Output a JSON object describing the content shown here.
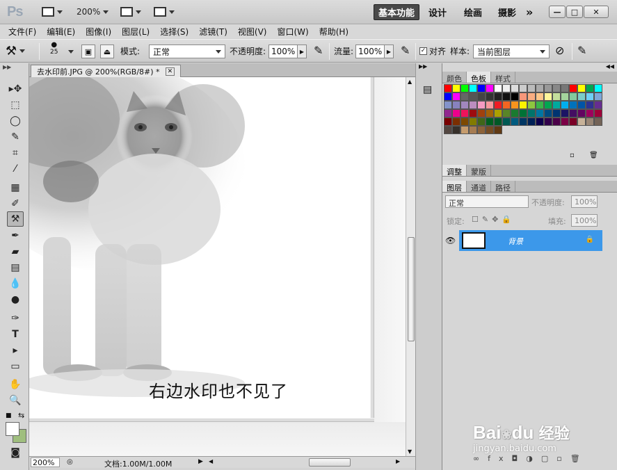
{
  "app": {
    "logo": "Ps",
    "zoom": "200%"
  },
  "workspaces": {
    "active": "基本功能",
    "design": "设计",
    "painting": "绘画",
    "photography": "摄影",
    "more": "»"
  },
  "window_controls": {
    "minimize": "—",
    "maximize": "□",
    "close": "✕"
  },
  "menu": [
    "文件(F)",
    "编辑(E)",
    "图像(I)",
    "图层(L)",
    "选择(S)",
    "滤镜(T)",
    "视图(V)",
    "窗口(W)",
    "帮助(H)"
  ],
  "options": {
    "brush_size": "25",
    "mode_label": "模式:",
    "mode_value": "正常",
    "opacity_label": "不透明度:",
    "opacity_value": "100%",
    "flow_label": "流量:",
    "flow_value": "100%",
    "align_label": "对齐",
    "sample_label": "样本:",
    "sample_value": "当前图层"
  },
  "document": {
    "tab_title": "去水印前.JPG @ 200%(RGB/8#) *",
    "caption": "右边水印也不见了"
  },
  "status": {
    "zoom": "200%",
    "doc_info": "文档:1.00M/1.00M"
  },
  "swatch_panel": {
    "tabs": [
      "颜色",
      "色板",
      "样式"
    ],
    "active": "色板"
  },
  "adjust_panel": {
    "tabs": [
      "调整",
      "蒙版"
    ]
  },
  "layers_panel": {
    "tabs": [
      "图层",
      "通道",
      "路径"
    ],
    "blend_mode": "正常",
    "opacity_label": "不透明度:",
    "opacity_value": "100%",
    "lock_label": "锁定:",
    "fill_label": "填充:",
    "fill_value": "100%",
    "layer_name": "背景"
  },
  "watermark": {
    "brand": "Bai",
    "brand2": "du",
    "cn": "经验",
    "url": "jingyan.baidu.com"
  },
  "swatch_colors": [
    "#ff0000",
    "#ffff00",
    "#00ff00",
    "#00ffff",
    "#0000ff",
    "#ff00ff",
    "#ffffff",
    "#eeeeee",
    "#dddddd",
    "#cccccc",
    "#bbbbbb",
    "#aaaaaa",
    "#999999",
    "#888888",
    "#777777",
    "#ff0000",
    "#ffff00",
    "#00a651",
    "#00ffff",
    "#0000ff",
    "#ff00ff",
    "#666666",
    "#555555",
    "#444444",
    "#333333",
    "#222222",
    "#111111",
    "#000000",
    "#f7977a",
    "#f9ad81",
    "#fdc68a",
    "#fff79a",
    "#c4df9b",
    "#a3d39c",
    "#82ca9d",
    "#7bcdc8",
    "#6ecff6",
    "#7ea7d8",
    "#8493ca",
    "#8882be",
    "#a187be",
    "#bc8dbf",
    "#f49ac2",
    "#f6989d",
    "#ed1c24",
    "#f26522",
    "#f7941d",
    "#fff200",
    "#8dc63f",
    "#39b54a",
    "#00a651",
    "#00a99d",
    "#00aeef",
    "#0072bc",
    "#0054a6",
    "#2e3192",
    "#662d91",
    "#92278f",
    "#ec008c",
    "#ed145b",
    "#9e0b0f",
    "#a0410d",
    "#a36209",
    "#aba000",
    "#598527",
    "#1a7b30",
    "#007236",
    "#00746b",
    "#0076a3",
    "#004b80",
    "#003471",
    "#1b1464",
    "#440e62",
    "#630460",
    "#9e005d",
    "#9e0039",
    "#790000",
    "#7b2e00",
    "#7d4900",
    "#827b00",
    "#406618",
    "#005e20",
    "#005826",
    "#005952",
    "#005b7f",
    "#003663",
    "#002157",
    "#0d004c",
    "#32004b",
    "#4b0049",
    "#7b0046",
    "#7a0026",
    "#c7b299",
    "#998675",
    "#736357",
    "#534741",
    "#37302a",
    "#c69c6d",
    "#a67c52",
    "#8c6239",
    "#754c24",
    "#603913"
  ]
}
